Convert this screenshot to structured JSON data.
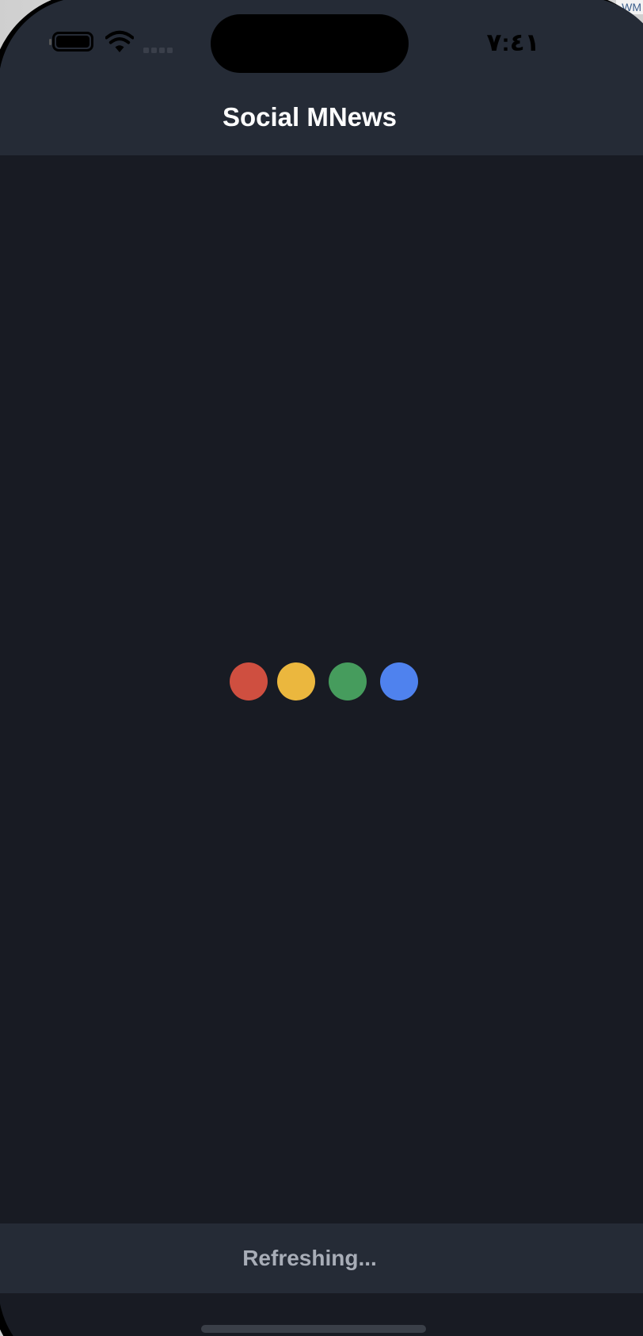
{
  "status_bar": {
    "time": "٧:٤١",
    "battery_icon": "battery-icon",
    "wifi_icon": "wifi-icon",
    "signal_icon": "cellular-signal-icon"
  },
  "nav": {
    "title": "Social MNews"
  },
  "loader": {
    "dots": [
      {
        "name": "red-dot",
        "color": "#cf4f40"
      },
      {
        "name": "yellow-dot",
        "color": "#ebb73e"
      },
      {
        "name": "green-dot",
        "color": "#469c5d"
      },
      {
        "name": "blue-dot",
        "color": "#4f82ee"
      }
    ]
  },
  "footer": {
    "status_text": "Refreshing..."
  },
  "colors": {
    "background": "#181b23",
    "bar": "#252b36",
    "title_text": "#ffffff",
    "footer_text": "#a8adb7"
  }
}
